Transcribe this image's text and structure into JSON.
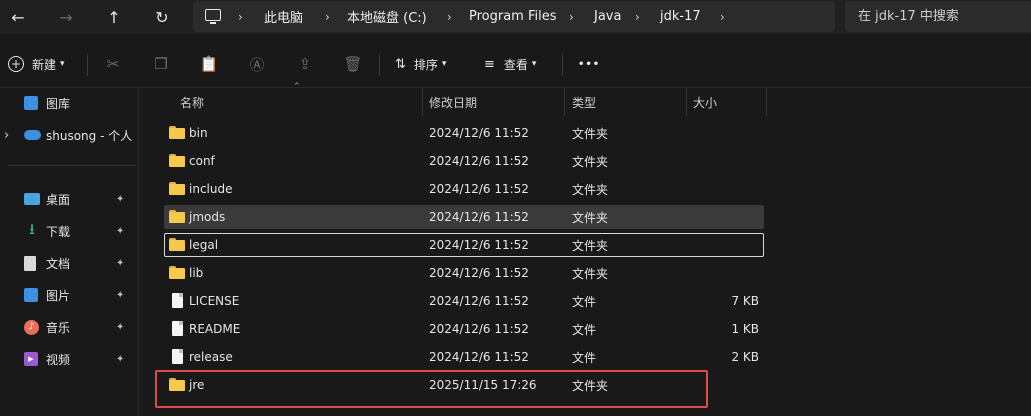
{
  "nav": {
    "back": "←",
    "forward": "→",
    "up": "↑",
    "refresh": "↻"
  },
  "address": {
    "crumbs": [
      "此电脑",
      "本地磁盘 (C:)",
      "Program Files",
      "Java",
      "jdk-17"
    ],
    "separator": "›"
  },
  "search": {
    "placeholder": "在 jdk-17 中搜索"
  },
  "toolbar": {
    "new_label": "新建",
    "sort_label": "排序",
    "view_label": "查看",
    "more_label": "•••"
  },
  "sidebar": {
    "items": [
      {
        "label": "图库",
        "icon": "gallery-icon"
      },
      {
        "label": "shusong - 个人",
        "icon": "onedrive-icon"
      },
      {
        "label": "桌面",
        "icon": "desktop-icon",
        "pinned": true
      },
      {
        "label": "下载",
        "icon": "download-icon",
        "pinned": true
      },
      {
        "label": "文档",
        "icon": "document-icon",
        "pinned": true
      },
      {
        "label": "图片",
        "icon": "pictures-icon",
        "pinned": true
      },
      {
        "label": "音乐",
        "icon": "music-icon",
        "pinned": true
      },
      {
        "label": "视频",
        "icon": "video-icon",
        "pinned": true
      }
    ],
    "expand_glyph": "›",
    "pin_glyph": "📌"
  },
  "columns": {
    "name": "名称",
    "modified": "修改日期",
    "type": "类型",
    "size": "大小"
  },
  "files": [
    {
      "name": "bin",
      "modified": "2024/12/6 11:52",
      "type": "文件夹",
      "size": "",
      "kind": "folder"
    },
    {
      "name": "conf",
      "modified": "2024/12/6 11:52",
      "type": "文件夹",
      "size": "",
      "kind": "folder"
    },
    {
      "name": "include",
      "modified": "2024/12/6 11:52",
      "type": "文件夹",
      "size": "",
      "kind": "folder"
    },
    {
      "name": "jmods",
      "modified": "2024/12/6 11:52",
      "type": "文件夹",
      "size": "",
      "kind": "folder"
    },
    {
      "name": "legal",
      "modified": "2024/12/6 11:52",
      "type": "文件夹",
      "size": "",
      "kind": "folder"
    },
    {
      "name": "lib",
      "modified": "2024/12/6 11:52",
      "type": "文件夹",
      "size": "",
      "kind": "folder"
    },
    {
      "name": "LICENSE",
      "modified": "2024/12/6 11:52",
      "type": "文件",
      "size": "7 KB",
      "kind": "file"
    },
    {
      "name": "README",
      "modified": "2024/12/6 11:52",
      "type": "文件",
      "size": "1 KB",
      "kind": "file"
    },
    {
      "name": "release",
      "modified": "2024/12/6 11:52",
      "type": "文件",
      "size": "2 KB",
      "kind": "file"
    },
    {
      "name": "jre",
      "modified": "2025/11/15 17:26",
      "type": "文件夹",
      "size": "",
      "kind": "folder"
    }
  ],
  "colors": {
    "background": "#191919",
    "folder": "#f6c84b",
    "highlight": "#e0494a",
    "hover_row": "#3a3a3a"
  }
}
